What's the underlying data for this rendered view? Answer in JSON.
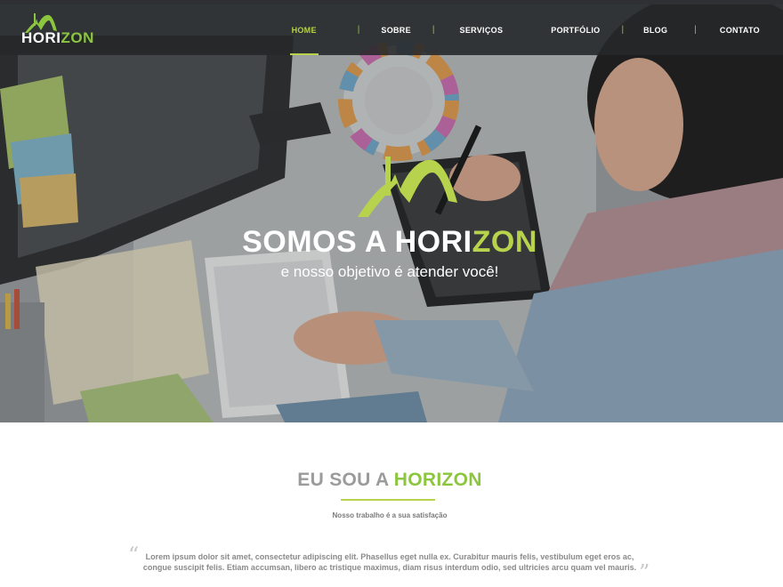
{
  "brand": {
    "logo_white": "HORI",
    "logo_green": "ZON",
    "accent": "#8cc63f",
    "accent_light": "#b7d24c"
  },
  "nav": {
    "items": [
      {
        "label": "HOME",
        "active": true
      },
      {
        "label": "SOBRE"
      },
      {
        "label": "SERVIÇOS"
      },
      {
        "label": "PORTFÓLIO"
      },
      {
        "label": "BLOG"
      },
      {
        "label": "CONTATO"
      }
    ],
    "separator": "|"
  },
  "hero": {
    "title_white": "SOMOS A HORI",
    "title_green": "ZON",
    "subtitle": "e nosso objetivo é atender você!"
  },
  "about": {
    "title_gray": "EU SOU A ",
    "title_green": "HORIZON",
    "tagline": "Nosso trabalho é a sua satisfação",
    "quote_open": "“",
    "quote_close": "”",
    "quote": "Lorem ipsum dolor sit amet, consectetur adipiscing elit. Phasellus eget nulla ex. Curabitur mauris felis, vestibulum eget eros ac, congue suscipit felis. Etiam accumsan, libero ac tristique maximus, diam risus interdum odio, sed ultricies arcu quam vel mauris."
  }
}
